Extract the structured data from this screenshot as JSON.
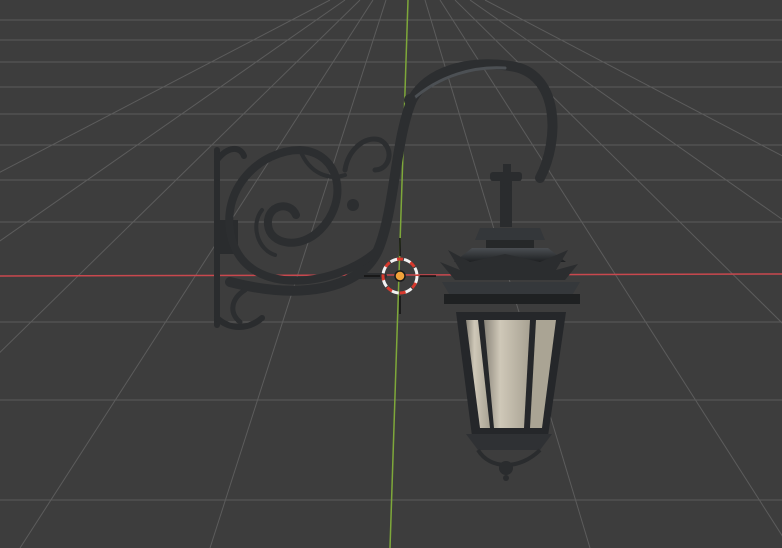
{
  "viewport": {
    "background": "#3d3d3d",
    "grid_color": "#5a5a5a",
    "x_axis_color": "#c9484e",
    "y_axis_color": "#7ea83a"
  },
  "scene": {
    "object_name": "street lamp",
    "metal_color": "#2a2c2e",
    "metal_highlight": "#5b5f63",
    "glass_color": "#bdb6a6"
  },
  "cursor_3d": {
    "ring_red": "#d83a2e",
    "ring_white": "#f2f2f2",
    "origin_color": "#f0a23a"
  }
}
